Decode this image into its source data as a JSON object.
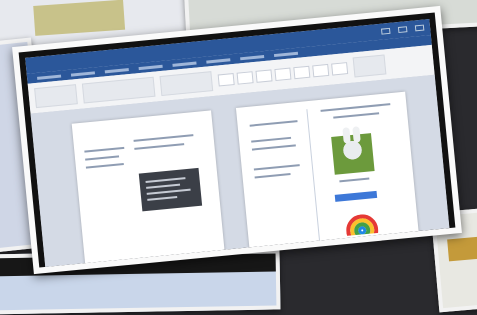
{
  "scene": {
    "subject": "",
    "background_color": "#2a2a2e",
    "frame_color": "#fafafa"
  },
  "word_window": {
    "titlebar_color": "#2b579a",
    "ribbon_color": "#f3f4f6",
    "canvas_color": "#d4dae5"
  },
  "pages": [],
  "icons": [
    "rabbit-photo",
    "rainbow-picture",
    "blue-button"
  ]
}
